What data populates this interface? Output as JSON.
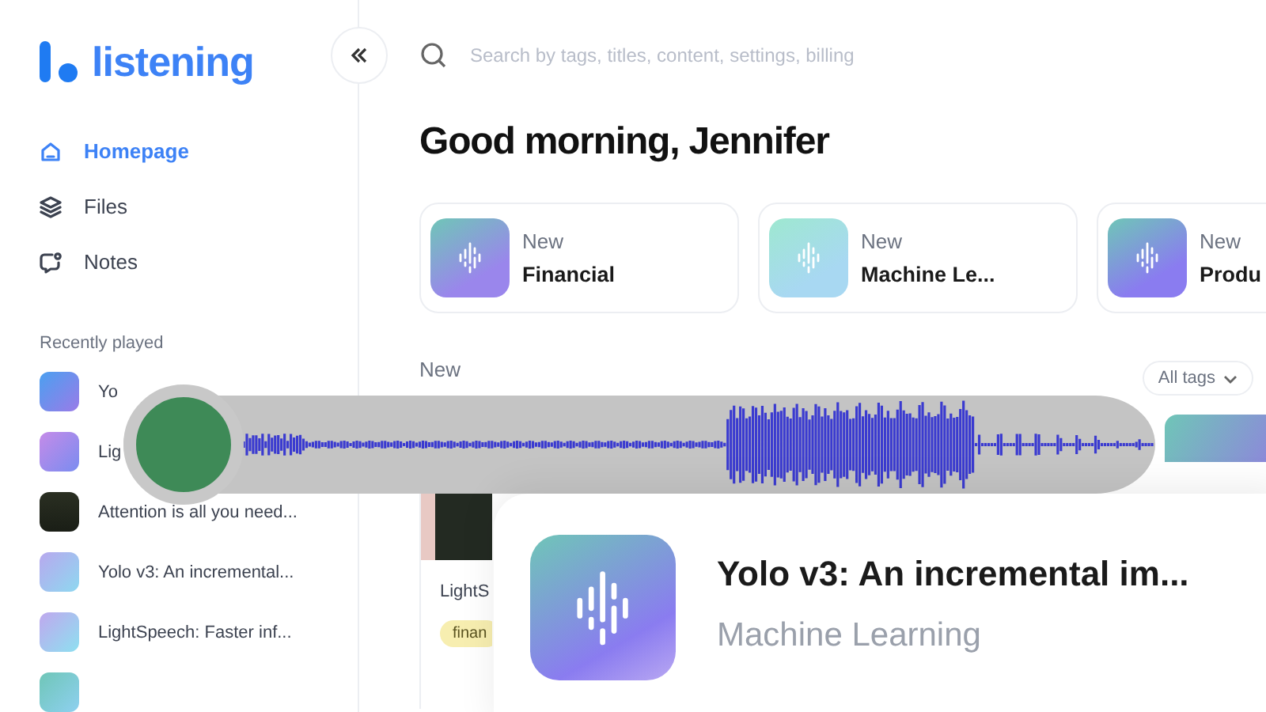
{
  "brand": {
    "name": "listening"
  },
  "nav": [
    {
      "label": "Homepage",
      "selected": true
    },
    {
      "label": "Files",
      "selected": false
    },
    {
      "label": "Notes",
      "selected": false
    }
  ],
  "recently_played": {
    "title": "Recently played",
    "items": [
      {
        "title": "Yo",
        "kind": "gradient"
      },
      {
        "title": "Lig",
        "kind": "gradient"
      },
      {
        "title": "Attention is all you need...",
        "kind": "cover"
      },
      {
        "title": "Yolo v3: An incremental...",
        "kind": "gradient"
      },
      {
        "title": "LightSpeech: Faster inf...",
        "kind": "gradient"
      },
      {
        "kind": "gradient"
      }
    ]
  },
  "search": {
    "placeholder": "Search by tags, titles, content, settings, billing"
  },
  "greeting": "Good morning, Jennifer",
  "collections": [
    {
      "caption": "New",
      "title": "Financial"
    },
    {
      "caption": "New",
      "title": "Machine Le..."
    },
    {
      "caption": "New",
      "title": "Produ"
    }
  ],
  "files_section": {
    "caption": "New",
    "filter": "All tags",
    "files": [
      {
        "title": "LightS",
        "tag": "finan"
      }
    ]
  },
  "player": {
    "playing_title": "Yolo v3: An incremental im...",
    "playing_category": "Machine Learning"
  }
}
